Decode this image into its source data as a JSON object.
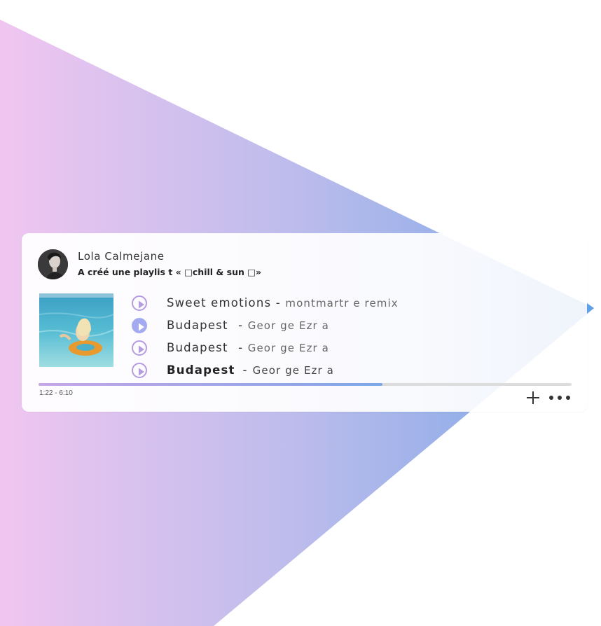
{
  "user": {
    "name": "Lola Calmejane",
    "activity": "A créé une playlis   t « □chill & sun  □»"
  },
  "tracks": [
    {
      "title": "Sweet emotions",
      "separator": "-",
      "artist": "montmartr   e remix",
      "active": false,
      "bold": false
    },
    {
      "title": "Budapest",
      "separator": "-",
      "artist": "Geor ge Ezr a",
      "active": true,
      "bold": false
    },
    {
      "title": "Budapest",
      "separator": "-",
      "artist": "Geor ge Ezr a",
      "active": false,
      "bold": false
    },
    {
      "title": "Budapest",
      "separator": "-",
      "artist": "Geor ge Ezr a",
      "active": false,
      "bold": true
    }
  ],
  "player": {
    "time": "1:22 - 6:10",
    "progress_fraction": 0.645
  },
  "icons": {
    "play": "play-icon",
    "add": "plus-icon",
    "more": "more-dots-icon"
  },
  "colors": {
    "gradient_start": "#f0c6f0",
    "gradient_end": "#7aa6e6",
    "play_outline": "#b59ce0",
    "play_active": "#a3aaf0"
  }
}
